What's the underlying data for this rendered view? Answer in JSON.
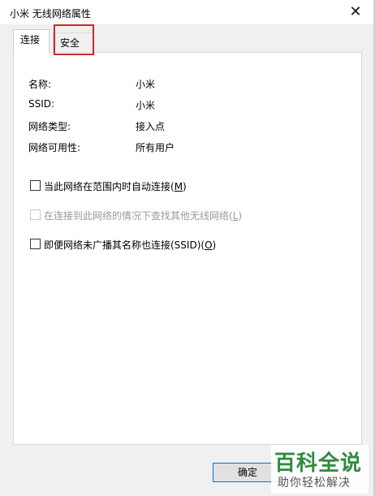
{
  "window": {
    "title": "小米 无线网络属性",
    "close_glyph": "✕"
  },
  "tabs": [
    {
      "label": "连接",
      "active": true
    },
    {
      "label": "安全",
      "active": false,
      "highlighted": true
    }
  ],
  "properties": [
    {
      "label": "名称:",
      "value": "小米"
    },
    {
      "label": "SSID:",
      "value": "小米"
    },
    {
      "label": "网络类型:",
      "value": "接入点"
    },
    {
      "label": "网络可用性:",
      "value": "所有用户"
    }
  ],
  "options": [
    {
      "text": "当此网络在范围内时自动连接(",
      "key": "M",
      "tail": ")",
      "checked": false,
      "enabled": true
    },
    {
      "text": "在连接到此网络的情况下查找其他无线网络(",
      "key": "L",
      "tail": ")",
      "checked": false,
      "enabled": false
    },
    {
      "text": "即便网络未广播其名称也连接(SSID)(",
      "key": "O",
      "tail": ")",
      "checked": false,
      "enabled": true
    }
  ],
  "buttons": {
    "ok_label": "确定"
  },
  "watermark": {
    "brand": "百科全说",
    "slogan": "助你轻松解决"
  },
  "colors": {
    "highlight_border": "#cc2b2b",
    "focus_border": "#0078d7",
    "watermark_green": "#2e8b3e"
  }
}
